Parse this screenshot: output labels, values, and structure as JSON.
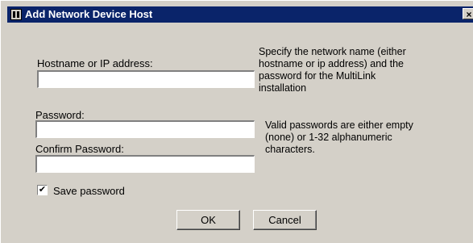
{
  "window": {
    "title": "Add Network Device Host",
    "close_glyph": "×"
  },
  "form": {
    "hostname_label": "Hostname or IP address:",
    "hostname_value": "",
    "password_label": "Password:",
    "password_value": "",
    "confirm_label": "Confirm Password:",
    "confirm_value": "",
    "save_password_label": "Save password",
    "save_password_checked": true
  },
  "help": {
    "network_line1": "Specify the network name (either",
    "network_line2": "hostname or ip address) and the",
    "network_line3": "password for the MultiLink",
    "network_line4": "installation",
    "password_line1": "Valid passwords are either empty",
    "password_line2": "(none) or 1-32 alphanumeric",
    "password_line3": "characters."
  },
  "buttons": {
    "ok": "OK",
    "cancel": "Cancel"
  }
}
